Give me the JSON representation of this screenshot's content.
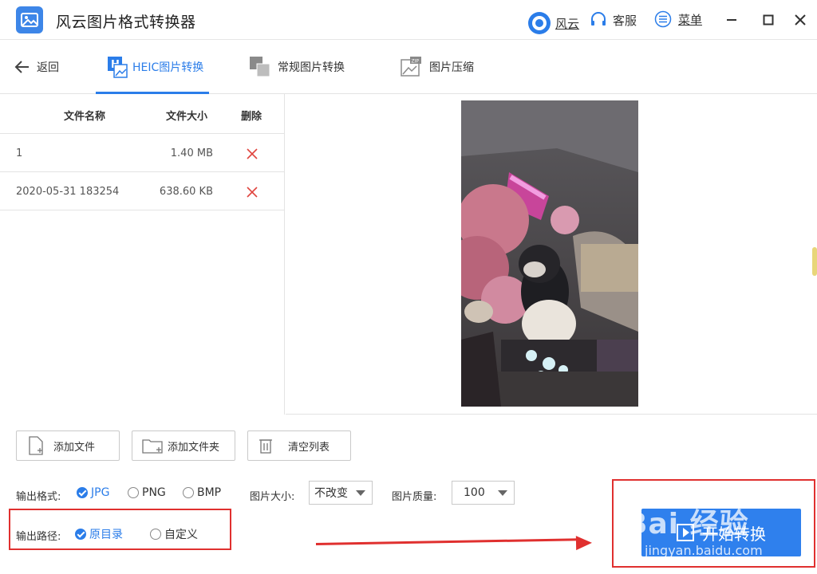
{
  "app": {
    "title": "风云图片格式转换器",
    "brand_color": "#2b7de9",
    "account_label": "风云",
    "service_label": "客服",
    "menu_label": "菜单"
  },
  "nav": {
    "back_label": "返回",
    "tabs": [
      {
        "label": "HEIC图片转换",
        "active": true,
        "icon": "heic-icon"
      },
      {
        "label": "常规图片转换",
        "active": false,
        "icon": "convert-icon"
      },
      {
        "label": "图片压缩",
        "active": false,
        "icon": "zip-image-icon"
      }
    ]
  },
  "file_list": {
    "columns": [
      "文件名称",
      "文件大小",
      "删除"
    ],
    "rows": [
      {
        "name": "1",
        "size": "1.40 MB"
      },
      {
        "name": "2020-05-31 183254",
        "size": "638.60 KB"
      }
    ]
  },
  "actions": {
    "add_file": "添加文件",
    "add_folder": "添加文件夹",
    "clear_list": "清空列表"
  },
  "options": {
    "format_label": "输出格式:",
    "formats": [
      {
        "label": "JPG",
        "checked": true
      },
      {
        "label": "PNG",
        "checked": false
      },
      {
        "label": "BMP",
        "checked": false
      }
    ],
    "size_label": "图片大小:",
    "size_value": "不改变",
    "quality_label": "图片质量:",
    "quality_value": "100",
    "path_label": "输出路径:",
    "paths": [
      {
        "label": "原目录",
        "checked": true
      },
      {
        "label": "自定义",
        "checked": false
      }
    ]
  },
  "start_label": "开始转换",
  "watermark": {
    "main": "Bai 经验",
    "sub": "jingyan.baidu.com"
  }
}
